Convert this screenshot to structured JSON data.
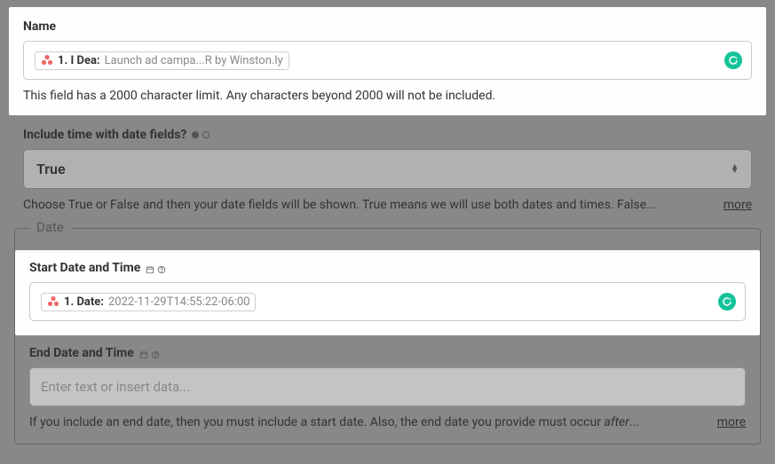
{
  "name_section": {
    "label": "Name",
    "pill_prefix": "1. I Dea:",
    "pill_value": "Launch ad campa...R by Winston.ly",
    "helper": "This field has a 2000 character limit. Any characters beyond 2000 will not be included."
  },
  "include_time": {
    "label": "Include time with date fields?",
    "value": "True",
    "helper": "Choose True or False and then your date fields will be shown. True means we will use both dates and times. False...",
    "more_label": "more"
  },
  "date_group": {
    "legend": "Date",
    "start": {
      "label": "Start Date and Time",
      "pill_prefix": "1. Date:",
      "pill_value": "2022-11-29T14:55:22-06:00"
    },
    "end": {
      "label": "End Date and Time",
      "placeholder": "Enter text or insert data...",
      "helper_prefix": "If you include an end date, then you must include a start date. Also, the end date you provide must occur ",
      "helper_italic": "after",
      "helper_suffix": "...",
      "more_label": "more"
    }
  },
  "colors": {
    "grammarly": "#15c39a",
    "asana_orange": "#f06a6a"
  }
}
